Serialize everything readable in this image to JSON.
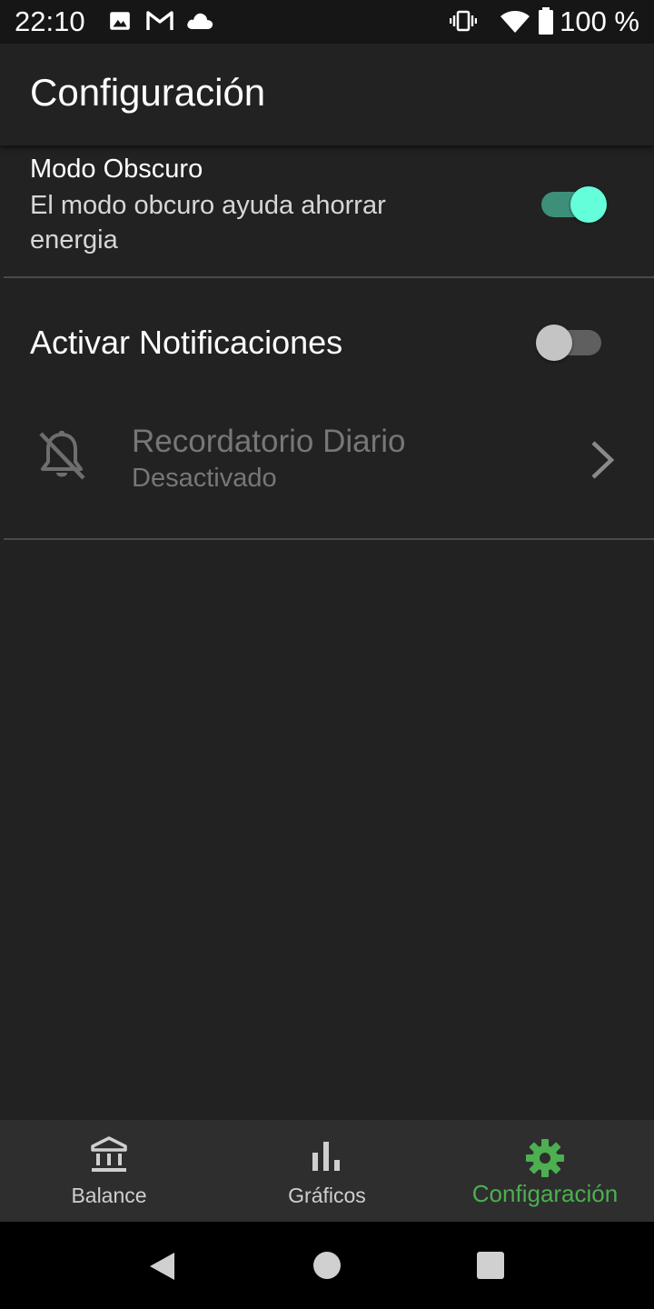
{
  "status_bar": {
    "time": "22:10",
    "battery_text": "100 %",
    "icons": [
      "image-icon",
      "gmail-icon",
      "cloud-icon",
      "vibrate-icon",
      "wifi-icon",
      "battery-icon"
    ]
  },
  "app_bar": {
    "title": "Configuración"
  },
  "settings": {
    "dark_mode": {
      "title": "Modo Obscuro",
      "description": "El modo obcuro ayuda ahorrar energia",
      "enabled": true
    },
    "notifications": {
      "label": "Activar Notificaciones",
      "enabled": false
    },
    "daily_reminder": {
      "title": "Recordatorio Diario",
      "status": "Desactivado",
      "icon": "bell-off-icon"
    }
  },
  "bottom_nav": {
    "items": [
      {
        "label": "Balance",
        "icon": "bank-icon",
        "active": false
      },
      {
        "label": "Gráficos",
        "icon": "bar-chart-icon",
        "active": false
      },
      {
        "label": "Configaración",
        "icon": "gear-icon",
        "active": true
      }
    ]
  },
  "system_nav": {
    "buttons": [
      "back-icon",
      "home-icon",
      "recents-icon"
    ]
  },
  "colors": {
    "background": "#222222",
    "accent_green": "#4caf50",
    "toggle_on_thumb": "#64ffda",
    "toggle_on_track": "#3e8f7a",
    "disabled_text": "#777777"
  }
}
